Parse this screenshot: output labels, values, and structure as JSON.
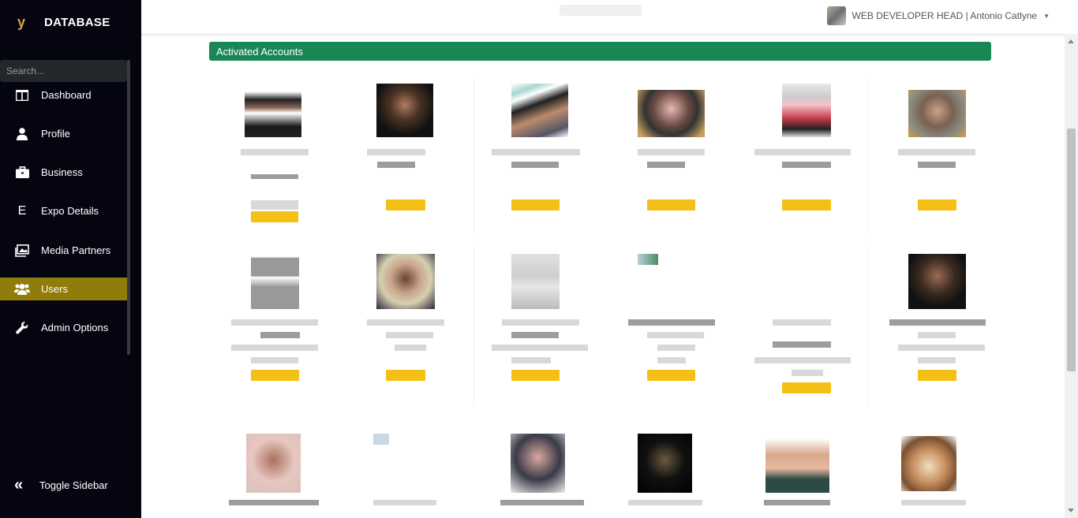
{
  "app": {
    "logo_glyph": "y",
    "title": "DATABASE"
  },
  "sidebar": {
    "search_placeholder": "Search...",
    "items": [
      {
        "label": "Dashboard",
        "icon": "columns-icon"
      },
      {
        "label": "Profile",
        "icon": "user-icon"
      },
      {
        "label": "Business",
        "icon": "briefcase-icon"
      },
      {
        "label": "Expo Details",
        "icon": "letter-e-icon"
      },
      {
        "label": "Media Partners",
        "icon": "images-icon"
      },
      {
        "label": "Users",
        "icon": "users-icon",
        "active": true
      },
      {
        "label": "Admin Options",
        "icon": "wrench-icon"
      }
    ],
    "toggle_label": "Toggle Sidebar"
  },
  "topbar": {
    "user_role": "WEB DEVELOPER HEAD | Antonio Catlyne"
  },
  "main": {
    "panel_title": "Activated Accounts"
  },
  "colors": {
    "sidebar_bg": "#050512",
    "active_item": "#8f7c09",
    "panel_header": "#198754",
    "badge": "#f5c015"
  }
}
